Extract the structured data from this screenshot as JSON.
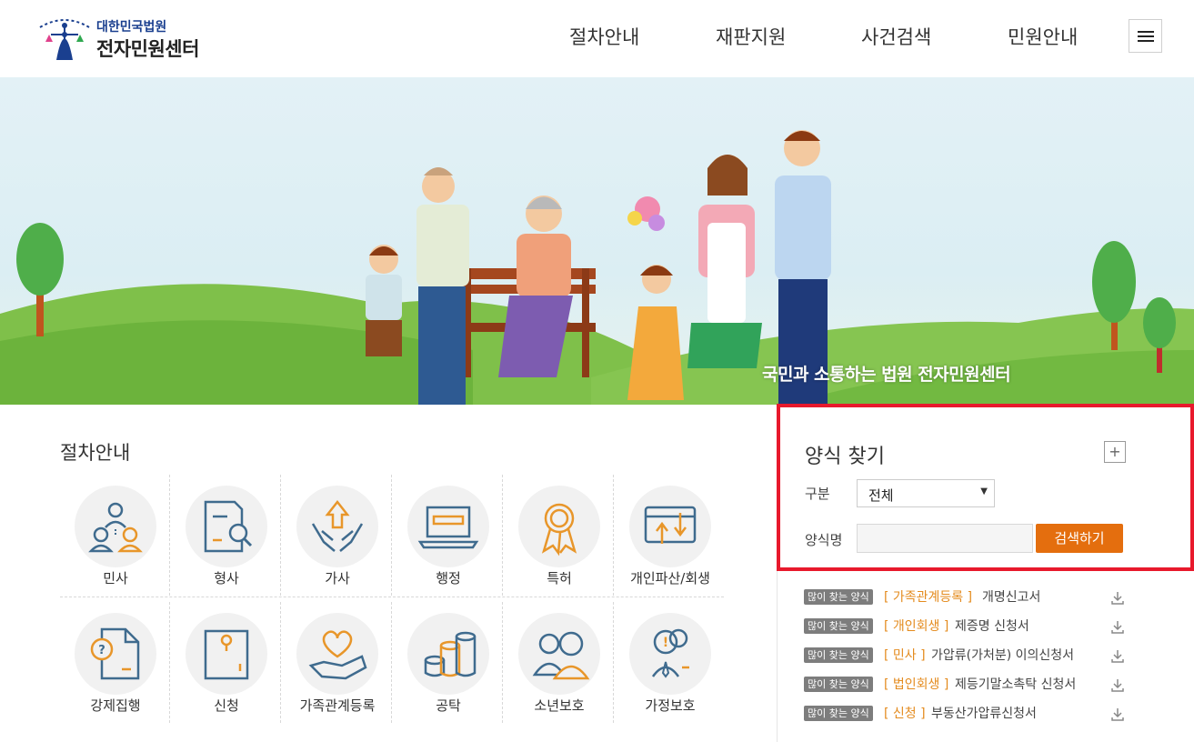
{
  "header": {
    "logo_small": "대한민국법원",
    "logo_big": "전자민원센터",
    "nav": [
      "절차안내",
      "재판지원",
      "사건검색",
      "민원안내"
    ]
  },
  "banner": {
    "caption": "국민과 소통하는 법원 전자민원센터"
  },
  "procedures": {
    "title": "절차안내",
    "items": [
      {
        "label": "민사",
        "icon": "people-network-icon"
      },
      {
        "label": "형사",
        "icon": "document-magnifier-icon"
      },
      {
        "label": "가사",
        "icon": "hands-house-icon"
      },
      {
        "label": "행정",
        "icon": "laptop-icon"
      },
      {
        "label": "특허",
        "icon": "award-ribbon-icon"
      },
      {
        "label": "개인파산/회생",
        "icon": "card-arrows-icon"
      },
      {
        "label": "강제집행",
        "icon": "question-document-icon"
      },
      {
        "label": "신청",
        "icon": "envelope-icon"
      },
      {
        "label": "가족관계등록",
        "icon": "heart-hand-icon"
      },
      {
        "label": "공탁",
        "icon": "coins-icon"
      },
      {
        "label": "소년보호",
        "icon": "two-people-icon"
      },
      {
        "label": "가정보호",
        "icon": "person-magnifier-icon"
      }
    ]
  },
  "form_search": {
    "title": "양식 찾기",
    "plus": "+",
    "category_label": "구분",
    "category_value": "전체",
    "name_label": "양식명",
    "name_value": "",
    "button": "검색하기"
  },
  "popular_forms": [
    {
      "badge": "많이 찾는 양식",
      "category": "[ 가족관계등록 ]",
      "name": "개명신고서"
    },
    {
      "badge": "많이 찾는 양식",
      "category": "[ 개인회생 ]",
      "name": "제증명 신청서"
    },
    {
      "badge": "많이 찾는 양식",
      "category": "[ 민사 ]",
      "name": "가압류(가처분) 이의신청서"
    },
    {
      "badge": "많이 찾는 양식",
      "category": "[ 법인회생 ]",
      "name": "제등기말소촉탁 신청서"
    },
    {
      "badge": "많이 찾는 양식",
      "category": "[ 신청 ]",
      "name": "부동산가압류신청서"
    }
  ],
  "colors": {
    "accent_orange": "#e46e0e",
    "icon_blue": "#3f6b8e",
    "icon_orange": "#e8962a",
    "highlight_red": "#e8192c"
  }
}
